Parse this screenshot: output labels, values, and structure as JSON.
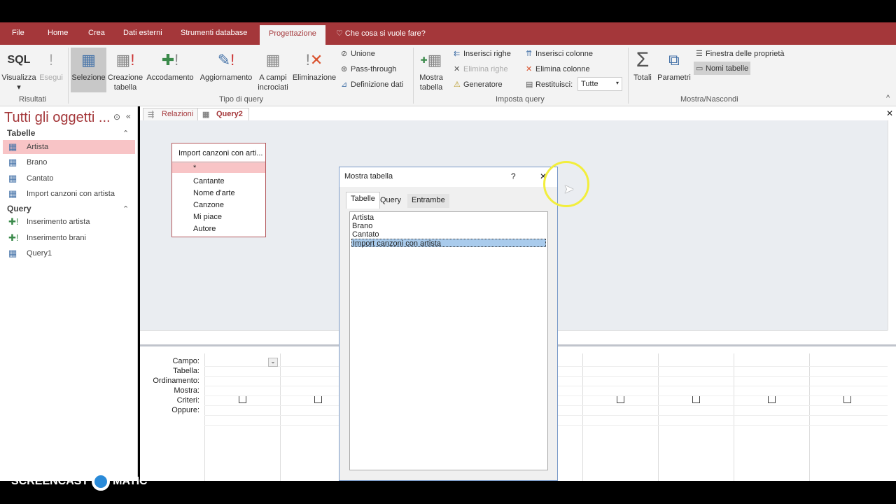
{
  "ribbon_tabs": [
    "File",
    "Home",
    "Crea",
    "Dati esterni",
    "Strumenti database",
    "Progettazione"
  ],
  "tell_me": "Che cosa si vuole fare?",
  "ribbon": {
    "visualizza": "Visualizza",
    "sql": "SQL",
    "esegui": "Esegui",
    "risultati": "Risultati",
    "selezione": "Selezione",
    "creazione1": "Creazione",
    "creazione2": "tabella",
    "accodamento": "Accodamento",
    "aggiornamento": "Aggiornamento",
    "acampi1": "A campi",
    "acampi2": "incrociati",
    "eliminazione": "Eliminazione",
    "unione": "Unione",
    "passthrough": "Pass-through",
    "definizione": "Definizione dati",
    "tipo_query": "Tipo di query",
    "mostra1": "Mostra",
    "mostra2": "tabella",
    "inserisci_righe": "Inserisci righe",
    "elimina_righe": "Elimina righe",
    "generatore": "Generatore",
    "inserisci_colonne": "Inserisci colonne",
    "elimina_colonne": "Elimina colonne",
    "restituisci": "Restituisci:",
    "restituisci_value": "Tutte",
    "imposta_query": "Imposta query",
    "totali": "Totali",
    "parametri": "Parametri",
    "finestra": "Finestra delle proprietà",
    "nomi_tabelle": "Nomi tabelle",
    "mostra_nascondi": "Mostra/Nascondi"
  },
  "nav": {
    "title": "Tutti gli oggetti ...",
    "tabelle_header": "Tabelle",
    "tabelle": [
      "Artista",
      "Brano",
      "Cantato",
      "Import canzoni con artista"
    ],
    "query_header": "Query",
    "queries": [
      "Inserimento artista",
      "Inserimento brani",
      "Query1"
    ]
  },
  "doc_tabs": [
    "Relazioni",
    "Query2"
  ],
  "field_list": {
    "title": "Import canzoni con arti...",
    "fields": [
      "*",
      "Cantante",
      "Nome d'arte",
      "Canzone",
      "Mi piace",
      "Autore"
    ]
  },
  "grid_rows": [
    "Campo:",
    "Tabella:",
    "Ordinamento:",
    "Mostra:",
    "Criteri:",
    "Oppure:"
  ],
  "dialog": {
    "title": "Mostra tabella",
    "help": "?",
    "close": "✕",
    "tabs": [
      "Tabelle",
      "Query",
      "Entrambe"
    ],
    "items": [
      "Artista",
      "Brano",
      "Cantato",
      "Import canzoni con artista"
    ],
    "selected": "Import canzoni con artista"
  },
  "watermark": {
    "line1": "RECORDED WITH",
    "line2": "SCREENCAST",
    "line3": "MATIC"
  },
  "colors": {
    "accent": "#a4373a",
    "selection": "#f8c4c6",
    "list_selection": "#a9cbec"
  }
}
